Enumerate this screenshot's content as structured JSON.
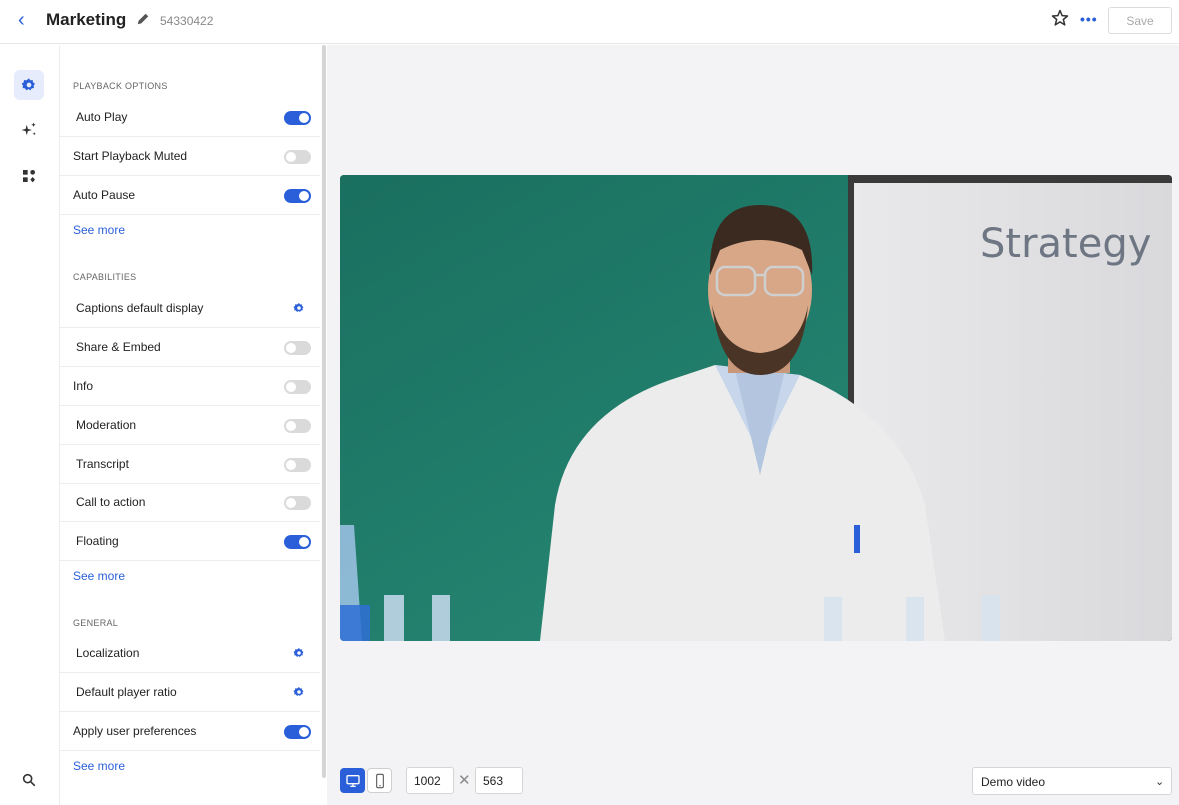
{
  "header": {
    "back_icon": "‹",
    "title": "Marketing",
    "player_id": "54330422",
    "more_icon": "•••",
    "save_label": "Save"
  },
  "rail": {
    "items": [
      "gear-icon",
      "sparkles-icon",
      "widgets-icon"
    ],
    "bottom_icon": "search-icon"
  },
  "sections": {
    "playback_title": "PLAYBACK OPTIONS",
    "capabilities_title": "CAPABILITIES",
    "general_title": "GENERAL"
  },
  "playback": {
    "auto_play": "Auto Play",
    "start_muted": "Start Playback Muted",
    "auto_pause": "Auto Pause",
    "see_more": "See more"
  },
  "capabilities": {
    "captions": "Captions default display",
    "share_embed": "Share & Embed",
    "info": "Info",
    "moderation": "Moderation",
    "transcript": "Transcript",
    "cta": "Call to action",
    "floating": "Floating",
    "see_more": "See more"
  },
  "general": {
    "localization": "Localization",
    "ratio": "Default player ratio",
    "user_prefs": "Apply user preferences",
    "see_more": "See more"
  },
  "toggles": {
    "auto_play": true,
    "start_muted": false,
    "auto_pause": true,
    "share_embed": false,
    "info": false,
    "moderation": false,
    "transcript": false,
    "cta": false,
    "floating": true,
    "user_prefs": true
  },
  "video": {
    "whiteboard_text": "Strategy"
  },
  "toolbar": {
    "width": "1002",
    "times": "✕",
    "height": "563",
    "select_value": "Demo video",
    "select_chevron": "⌄"
  },
  "colors": {
    "accent": "#2b5fd9",
    "toggle_off": "#dadada",
    "green_screen": "#1f7a6a"
  }
}
